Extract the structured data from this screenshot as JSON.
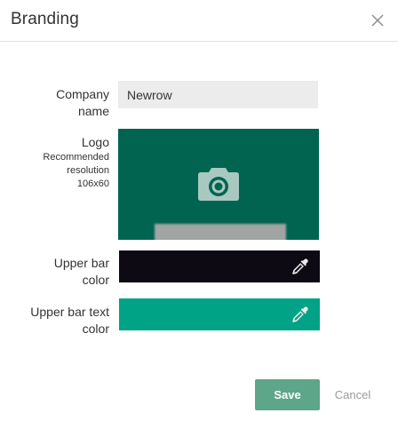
{
  "dialog": {
    "title": "Branding",
    "close_icon": "close-icon"
  },
  "company": {
    "label_line1": "Company",
    "label_line2": "name",
    "value": "Newrow"
  },
  "logo": {
    "label": "Logo",
    "hint_line1": "Recommended",
    "hint_line2": "resolution",
    "hint_line3": "106x60",
    "background_color": "#006450",
    "icon": "camera-icon"
  },
  "upper_bar_color": {
    "label_line1": "Upper bar",
    "label_line2": "color",
    "color": "#0d0a14",
    "icon": "eyedropper-icon"
  },
  "upper_bar_text_color": {
    "label_line1": "Upper bar text",
    "label_line2": "color",
    "color": "#00a385",
    "icon": "eyedropper-icon"
  },
  "actions": {
    "save_label": "Save",
    "cancel_label": "Cancel",
    "save_color": "#5ea68a"
  }
}
